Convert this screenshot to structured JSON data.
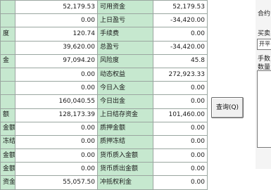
{
  "table": {
    "rows": [
      {
        "label": "",
        "value": "52,179.53",
        "label2": "可用资金",
        "value2": "52,179.53"
      },
      {
        "label": "",
        "value": "0.00",
        "label2": "上日盈亏",
        "value2": "-34,420.00"
      },
      {
        "label": "度",
        "value": "120.74",
        "label2": "手续费",
        "value2": "0.00"
      },
      {
        "label": "",
        "value": "39,620.00",
        "label2": "总盈亏",
        "value2": "-34,420.00"
      },
      {
        "label": "金",
        "value": "97,094.20",
        "label2": "风险度",
        "value2": "45.8"
      },
      {
        "label": "",
        "value": "0.00",
        "label2": "动态权益",
        "value2": "272,923.33"
      },
      {
        "label": "",
        "value": "0.00",
        "label2": "今日入金",
        "value2": "0.00"
      },
      {
        "label": "",
        "value": "160,040.55",
        "label2": "今日出金",
        "value2": "0.00"
      },
      {
        "label": "额",
        "value": "128,173.39",
        "label2": "上日结存资金",
        "value2": "101,460.00"
      },
      {
        "label": "金额",
        "value": "0.00",
        "label2": "质押金额",
        "value2": "0.00"
      },
      {
        "label": "冻结",
        "value": "0.00",
        "label2": "质押冻结",
        "value2": "0.00"
      },
      {
        "label": "金额",
        "value": "0.00",
        "label2": "货币质入金额",
        "value2": "0.00"
      },
      {
        "label": "金额",
        "value": "0.00",
        "label2": "货币质出金额",
        "value2": "0.00"
      },
      {
        "label": "资金",
        "value": "55,057.50",
        "label2": "冲抵权利金",
        "value2": "0.00"
      }
    ]
  },
  "query_button": {
    "label": "查询(Q)"
  },
  "side_panel": {
    "label_1": "合约",
    "label_2": "买卖",
    "input_value": "开平",
    "label_3": "手数",
    "label_4": "数量"
  }
}
